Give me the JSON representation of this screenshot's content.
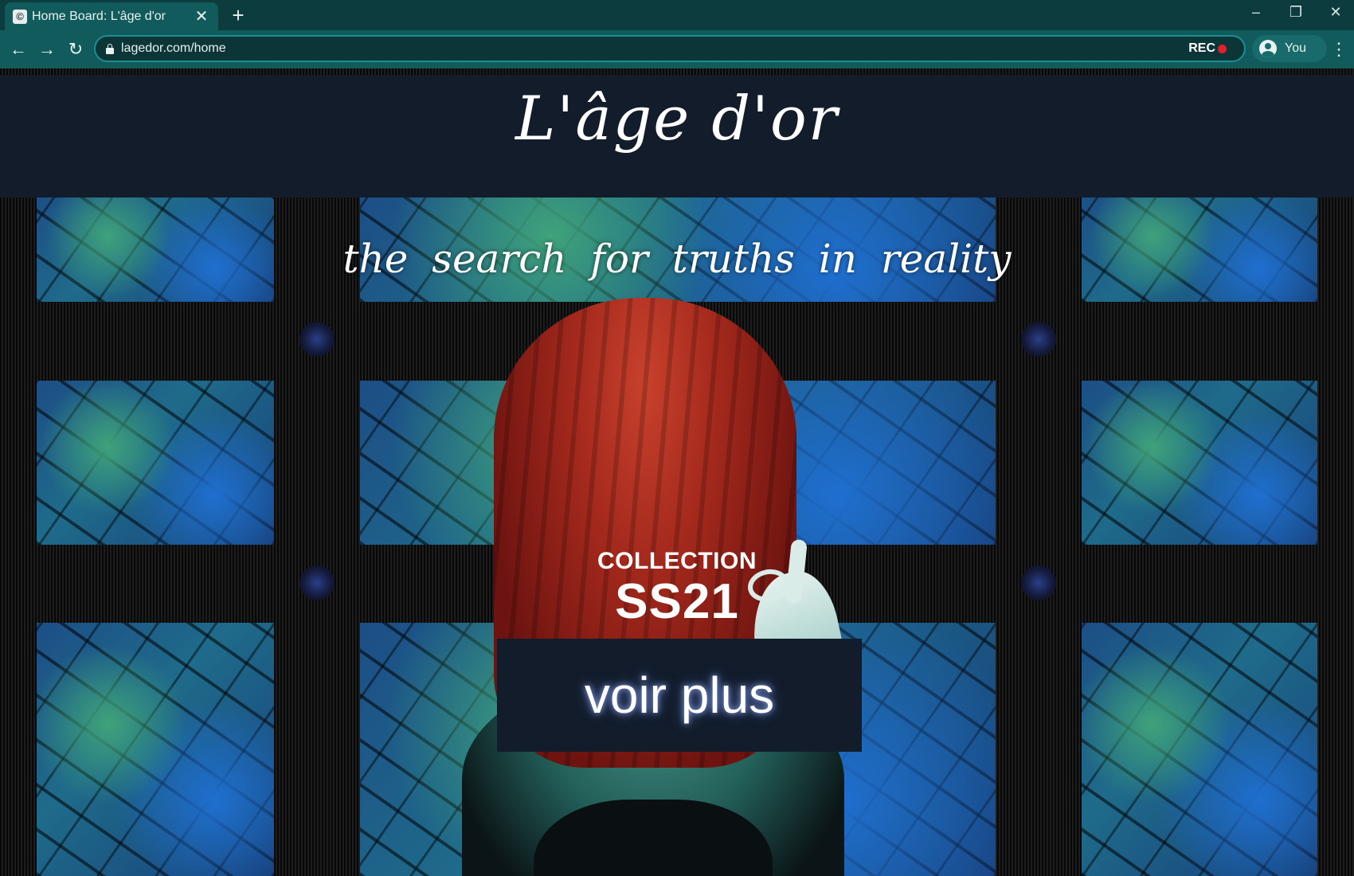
{
  "browser": {
    "tab_title": "Home Board: L'âge d'or",
    "favicon_glyph": "©",
    "tab_close": "✕",
    "new_tab": "+",
    "url": "lagedor.com/home",
    "rec_label": "REC",
    "profile_label": "You",
    "menu": "⋮",
    "back": "←",
    "forward": "→",
    "reload": "↻",
    "minimize": "–",
    "restore": "❐",
    "close": "✕"
  },
  "page": {
    "logo": "L'âge d'or",
    "tagline": "the search for truths in reality",
    "collection_label": "COLLECTION",
    "season": "SS21",
    "cta_label": "voir plus"
  },
  "colors": {
    "chrome_dark": "#0c3c3e",
    "chrome_tab": "#115b5c",
    "header_band": "#121c2b",
    "rec_dot": "#e0202a",
    "veil_red": "#a2281c"
  }
}
